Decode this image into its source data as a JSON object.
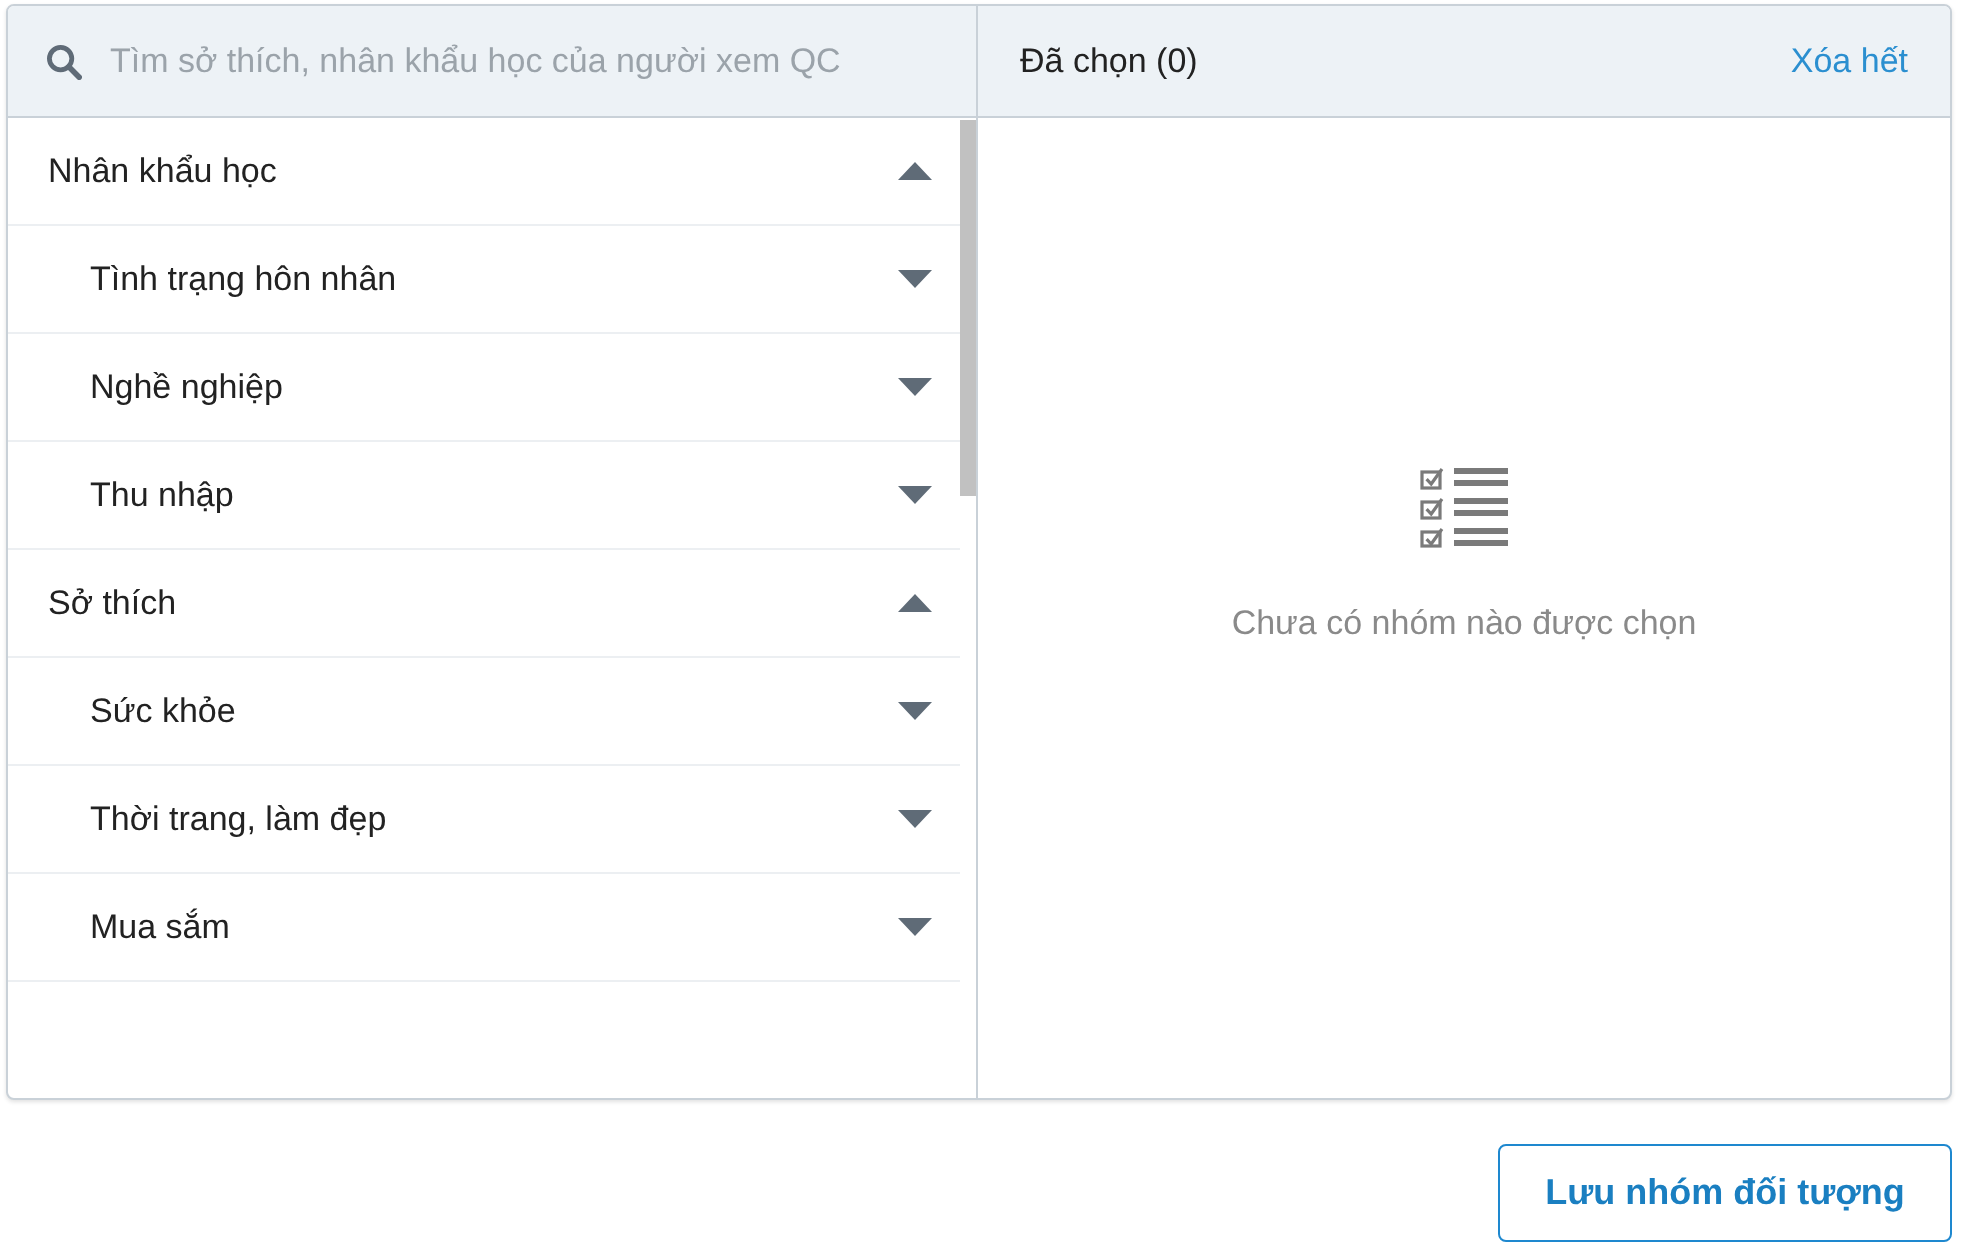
{
  "search": {
    "placeholder": "Tìm sở thích, nhân khẩu học của người xem QC"
  },
  "categories": [
    {
      "label": "Nhân khẩu học",
      "expanded": true,
      "children": [
        {
          "label": "Tình trạng hôn nhân",
          "expanded": false
        },
        {
          "label": "Nghề nghiệp",
          "expanded": false
        },
        {
          "label": "Thu nhập",
          "expanded": false
        }
      ]
    },
    {
      "label": "Sở thích",
      "expanded": true,
      "children": [
        {
          "label": "Sức khỏe",
          "expanded": false
        },
        {
          "label": "Thời trang, làm đẹp",
          "expanded": false
        },
        {
          "label": "Mua sắm",
          "expanded": false
        }
      ]
    }
  ],
  "selected_panel": {
    "title": "Đã chọn (0)",
    "clear_link": "Xóa hết",
    "empty_message": "Chưa có nhóm nào được chọn"
  },
  "save_button": "Lưu nhóm đối tượng"
}
